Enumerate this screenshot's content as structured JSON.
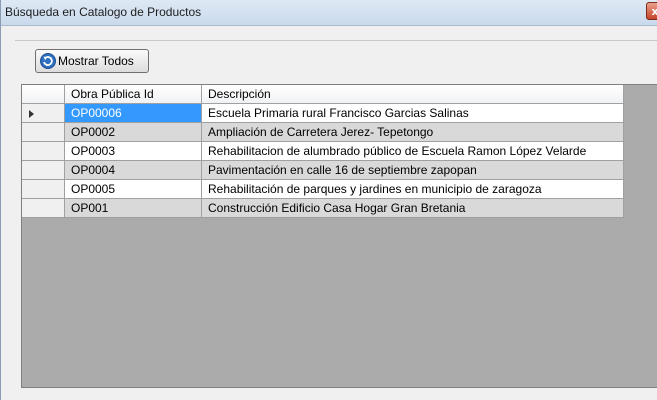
{
  "window": {
    "title": "Búsqueda en Catalogo de Productos",
    "close_label": "x"
  },
  "toolbar": {
    "show_all_label": "Mostrar Todos",
    "show_all_icon": "refresh-icon"
  },
  "grid": {
    "columns": [
      "",
      "Obra Pública Id",
      "Descripción"
    ],
    "selected_row_index": 0,
    "rows": [
      {
        "id": "OP00006",
        "descripcion": "Escuela Primaria rural Francisco Garcias Salinas"
      },
      {
        "id": "OP0002",
        "descripcion": "Ampliación de Carretera Jerez- Tepetongo"
      },
      {
        "id": "OP0003",
        "descripcion": "Rehabilitacion de alumbrado público de Escuela Ramon López Velarde"
      },
      {
        "id": "OP0004",
        "descripcion": "Pavimentación en calle 16 de septiembre  zapopan"
      },
      {
        "id": "OP0005",
        "descripcion": "Rehabilitación de parques y jardines en municipio de zaragoza"
      },
      {
        "id": "OP001",
        "descripcion": "Construcción Edificio Casa Hogar Gran Bretania"
      }
    ]
  },
  "colors": {
    "selection": "#3399ff",
    "grid_background": "#ababab",
    "alt_row": "#d9d9d9"
  }
}
